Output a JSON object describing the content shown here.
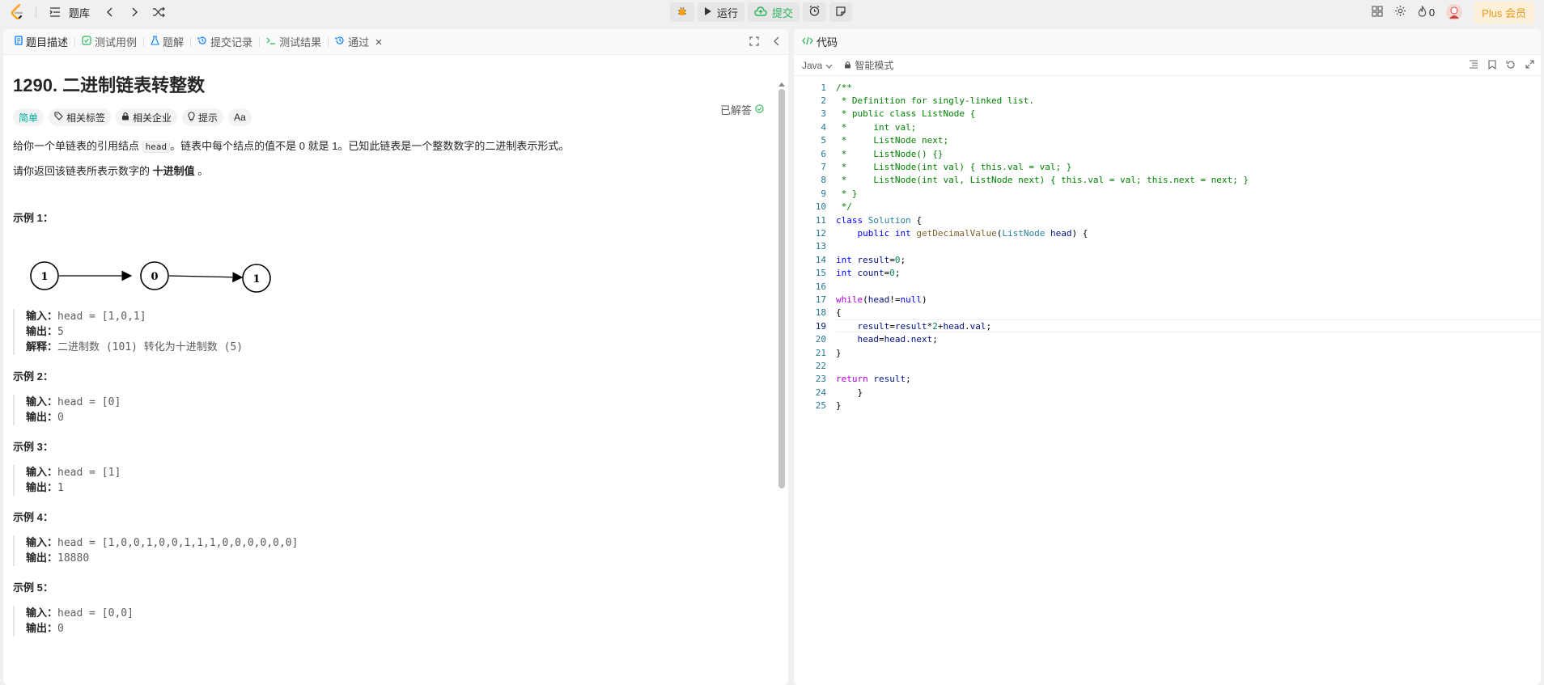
{
  "topbar": {
    "library_label": "题库",
    "run_label": "运行",
    "submit_label": "提交",
    "streak_count": "0",
    "plus_label": "Plus 会员"
  },
  "left": {
    "tabs": [
      {
        "label": "题目描述"
      },
      {
        "label": "测试用例"
      },
      {
        "label": "题解"
      },
      {
        "label": "提交记录"
      },
      {
        "label": "测试结果"
      },
      {
        "label": "通过"
      }
    ],
    "title": "1290. 二进制链表转整数",
    "solved_label": "已解答",
    "tags": [
      {
        "label": "简单"
      },
      {
        "label": "相关标签"
      },
      {
        "label": "相关企业"
      },
      {
        "label": "提示"
      },
      {
        "label": "Aa"
      }
    ],
    "desc1_a": "给你一个单链表的引用结点 ",
    "desc1_code": "head",
    "desc1_b": "。链表中每个结点的值不是 0 就是 1。已知此链表是一个整数数字的二进制表示形式。",
    "desc2_a": "请你返回该链表所表示数字的 ",
    "desc2_bold": "十进制值",
    "desc2_b": " 。",
    "diagram_nodes": [
      "1",
      "0",
      "1"
    ],
    "input_label": "输入：",
    "output_label": "输出：",
    "explain_label": "解释：",
    "examples": [
      {
        "title": "示例 1：",
        "input": "head = [1,0,1]",
        "output": "5",
        "explain": "二进制数 (101) 转化为十进制数 (5)"
      },
      {
        "title": "示例 2：",
        "input": "head = [0]",
        "output": "0"
      },
      {
        "title": "示例 3：",
        "input": "head = [1]",
        "output": "1"
      },
      {
        "title": "示例 4：",
        "input": "head = [1,0,0,1,0,0,1,1,1,0,0,0,0,0,0]",
        "output": "18880"
      },
      {
        "title": "示例 5：",
        "input": "head = [0,0]",
        "output": "0"
      }
    ]
  },
  "right": {
    "header_label": "代码",
    "language": "Java",
    "mode_label": "智能模式",
    "line_numbers": [
      "1",
      "2",
      "3",
      "4",
      "5",
      "6",
      "7",
      "8",
      "9",
      "10",
      "11",
      "12",
      "13",
      "14",
      "15",
      "16",
      "17",
      "18",
      "19",
      "20",
      "21",
      "22",
      "23",
      "24",
      "25"
    ]
  },
  "colors": {
    "accent_green": "#2db55d",
    "easy_teal": "#00af9b",
    "plus_orange": "#e79a1d"
  }
}
